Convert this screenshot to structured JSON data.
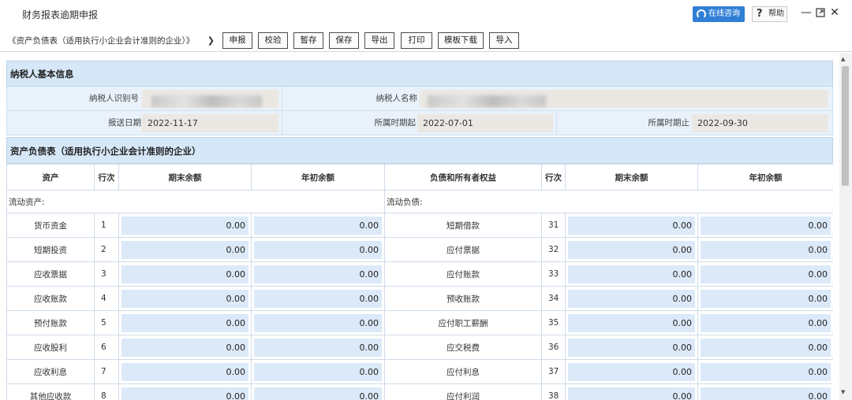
{
  "app": {
    "title": "财务报表逾期申报"
  },
  "titlebar": {
    "consult_label": "在线咨询",
    "help_label": "帮助",
    "help_glyph": "?"
  },
  "toolbar": {
    "report_select": "《资产负债表（适用执行小企业会计准则的企业）》",
    "buttons": [
      "申报",
      "校验",
      "暂存",
      "保存",
      "导出",
      "打印",
      "模板下载",
      "导入"
    ]
  },
  "taxpayer": {
    "section_title": "纳税人基本信息",
    "id_label": "纳税人识别号",
    "name_label": "纳税人名称",
    "submit_date_label": "报送日期",
    "submit_date": "2022-11-17",
    "period_start_label": "所属时期起",
    "period_start": "2022-07-01",
    "period_end_label": "所属时期止",
    "period_end": "2022-09-30"
  },
  "balance_sheet": {
    "section_title": "资产负债表（适用执行小企业会计准则的企业）",
    "headers": [
      "资产",
      "行次",
      "期末余额",
      "年初余额",
      "负债和所有者权益",
      "行次",
      "期末余额",
      "年初余额"
    ],
    "left_group": "流动资产:",
    "right_group": "流动负债:",
    "rows": [
      {
        "asset": "货币资金",
        "asset_line": "1",
        "asset_end": "0.00",
        "asset_begin": "0.00",
        "liab": "短期借款",
        "liab_line": "31",
        "liab_end": "0.00",
        "liab_begin": "0.00"
      },
      {
        "asset": "短期投资",
        "asset_line": "2",
        "asset_end": "0.00",
        "asset_begin": "0.00",
        "liab": "应付票据",
        "liab_line": "32",
        "liab_end": "0.00",
        "liab_begin": "0.00"
      },
      {
        "asset": "应收票据",
        "asset_line": "3",
        "asset_end": "0.00",
        "asset_begin": "0.00",
        "liab": "应付账款",
        "liab_line": "33",
        "liab_end": "0.00",
        "liab_begin": "0.00"
      },
      {
        "asset": "应收账款",
        "asset_line": "4",
        "asset_end": "0.00",
        "asset_begin": "0.00",
        "liab": "预收账款",
        "liab_line": "34",
        "liab_end": "0.00",
        "liab_begin": "0.00"
      },
      {
        "asset": "预付账款",
        "asset_line": "5",
        "asset_end": "0.00",
        "asset_begin": "0.00",
        "liab": "应付职工薪酬",
        "liab_line": "35",
        "liab_end": "0.00",
        "liab_begin": "0.00"
      },
      {
        "asset": "应收股利",
        "asset_line": "6",
        "asset_end": "0.00",
        "asset_begin": "0.00",
        "liab": "应交税费",
        "liab_line": "36",
        "liab_end": "0.00",
        "liab_begin": "0.00"
      },
      {
        "asset": "应收利息",
        "asset_line": "7",
        "asset_end": "0.00",
        "asset_begin": "0.00",
        "liab": "应付利息",
        "liab_line": "37",
        "liab_end": "0.00",
        "liab_begin": "0.00"
      },
      {
        "asset": "其他应收款",
        "asset_line": "8",
        "asset_end": "0.00",
        "asset_begin": "0.00",
        "liab": "应付利润",
        "liab_line": "38",
        "liab_end": "0.00",
        "liab_begin": "0.00"
      }
    ]
  },
  "colors": {
    "accent": "#2f7fd6",
    "section_bg": "#d6e8f8",
    "input_bg": "#dbe9f8"
  }
}
